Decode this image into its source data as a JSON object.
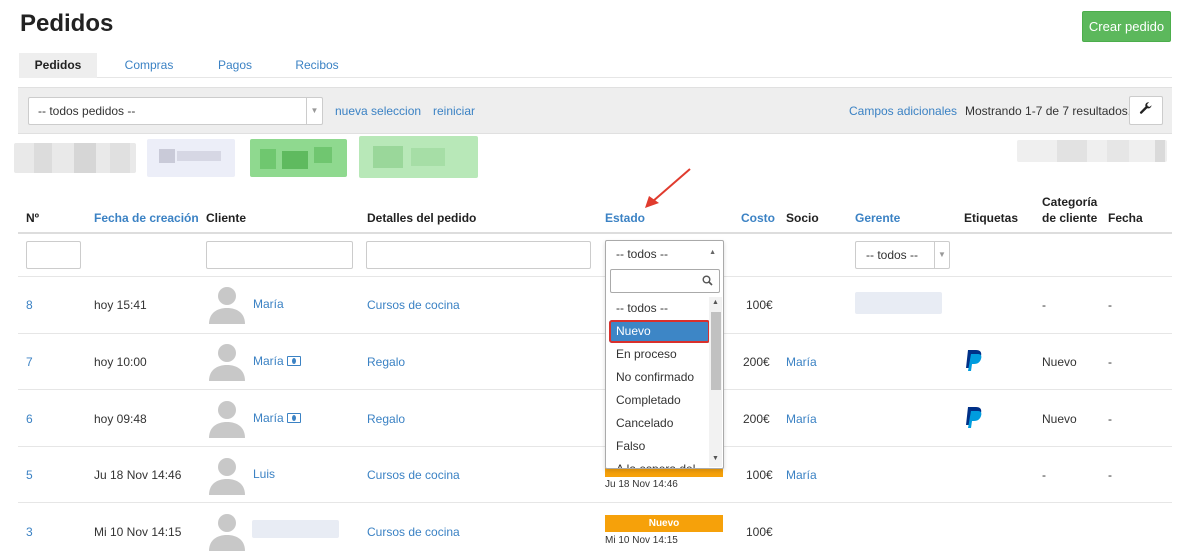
{
  "page": {
    "title": "Pedidos",
    "create_button": "Crear pedido"
  },
  "tabs": [
    "Pedidos",
    "Compras",
    "Pagos",
    "Recibos"
  ],
  "active_tab": "Pedidos",
  "filterbar": {
    "select_value": "-- todos pedidos --",
    "new_selection": "nueva seleccion",
    "reset": "reiniciar",
    "additional_fields": "Campos adicionales",
    "showing": "Mostrando 1-7 de 7 resultados."
  },
  "columns": {
    "number": "Nº",
    "created": "Fecha de creación",
    "client": "Cliente",
    "details": "Detalles del pedido",
    "status": "Estado",
    "cost": "Costo",
    "partner": "Socio",
    "manager": "Gerente",
    "tags": "Etiquetas",
    "client_category": "Categoría de cliente",
    "date": "Fecha"
  },
  "filters": {
    "status_value": "-- todos --",
    "manager_value": "-- todos --"
  },
  "status_dropdown": {
    "options": [
      "-- todos --",
      "Nuevo",
      "En proceso",
      "No confirmado",
      "Completado",
      "Cancelado",
      "Falso",
      "A la espera del"
    ],
    "highlighted": "Nuevo"
  },
  "rows": [
    {
      "number": "8",
      "created": "hoy 15:41",
      "client": "María",
      "client_icon": "",
      "details": "Cursos de cocina",
      "status": "",
      "status_date": "",
      "cost": "100€",
      "partner": "",
      "tag_icon": "",
      "category": "-",
      "date": "-"
    },
    {
      "number": "7",
      "created": "hoy 10:00",
      "client": "María",
      "client_icon": "money-icon",
      "details": "Regalo",
      "status": "",
      "status_date": "",
      "cost": "200€",
      "partner": "María",
      "tag_icon": "paypal-icon",
      "category": "Nuevo",
      "date": "-"
    },
    {
      "number": "6",
      "created": "hoy 09:48",
      "client": "María",
      "client_icon": "money-icon",
      "details": "Regalo",
      "status": "",
      "status_date": "",
      "cost": "200€",
      "partner": "María",
      "tag_icon": "paypal-icon",
      "category": "Nuevo",
      "date": "-"
    },
    {
      "number": "5",
      "created": "Ju 18 Nov 14:46",
      "client": "Luis",
      "client_icon": "",
      "details": "Cursos de cocina",
      "status": "",
      "status_date": "Ju 18 Nov 14:46",
      "cost": "100€",
      "partner": "María",
      "tag_icon": "",
      "category": "-",
      "date": "-"
    },
    {
      "number": "3",
      "created": "Mi 10 Nov 14:15",
      "client": "",
      "client_icon": "",
      "details": "Cursos de cocina",
      "status": "Nuevo",
      "status_date": "Mi 10 Nov 14:15",
      "cost": "100€",
      "partner": "",
      "tag_icon": "",
      "category": "",
      "date": ""
    }
  ],
  "colors": {
    "accent": "#3b82c4",
    "primary_button": "#5cb85c",
    "status_new": "#f6a10a",
    "highlight_outline": "#d9302c"
  }
}
